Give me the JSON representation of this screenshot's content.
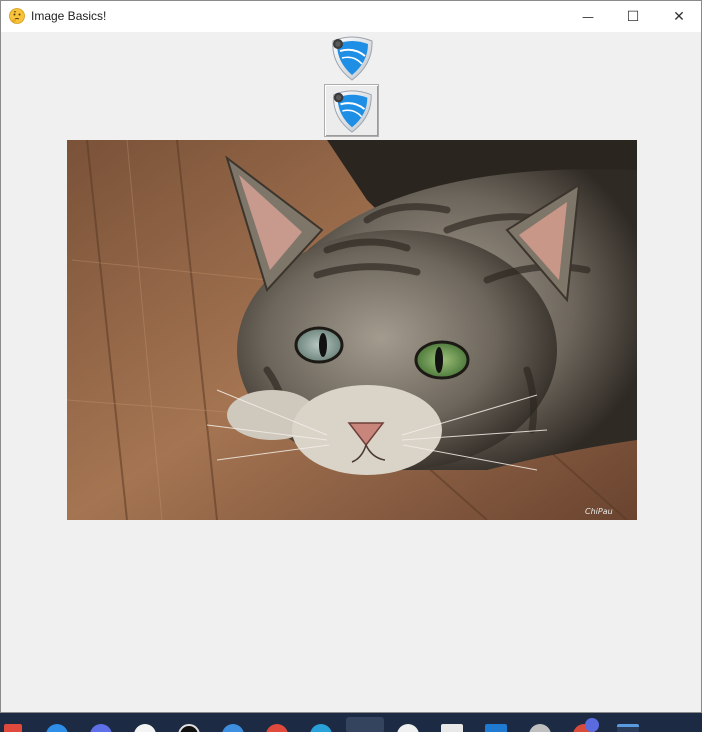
{
  "window": {
    "title": "Image Basics!",
    "controls": {
      "minimize": "—",
      "maximize": "☐",
      "close": "✕"
    }
  },
  "content": {
    "shield_label_icon": "shield-icon",
    "shield_button_icon": "shield-icon",
    "photo": {
      "subject": "cat-photo",
      "signature": "ChiPau"
    }
  },
  "colors": {
    "shield_blue": "#1f8fe6",
    "window_bg": "#f0f0f0",
    "taskbar": "#1c2a44"
  }
}
